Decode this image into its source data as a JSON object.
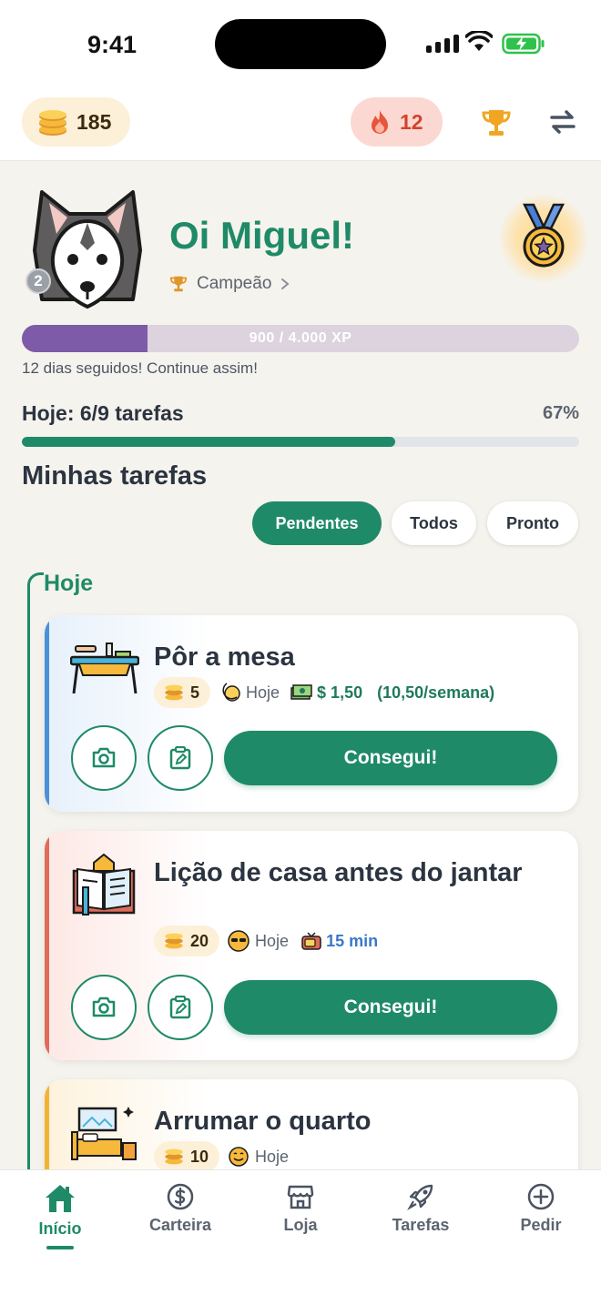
{
  "status_bar": {
    "time": "9:41"
  },
  "header": {
    "coins": "185",
    "streak": "12"
  },
  "profile": {
    "greeting": "Oi Miguel!",
    "rank_number": "2",
    "rank_name": "Campeão",
    "xp_text": "900 / 4.000 XP",
    "xp_progress": 0.225,
    "streak_message": "12 dias seguidos! Continue assim!"
  },
  "today": {
    "label": "Hoje: 6/9 tarefas",
    "percent": "67%",
    "progress": 0.67
  },
  "tasks_section": {
    "title": "Minhas tarefas",
    "tabs": [
      "Pendentes",
      "Todos",
      "Pronto"
    ],
    "group_label": "Hoje"
  },
  "tasks": [
    {
      "title": "Pôr a mesa",
      "coins": "5",
      "when": "Hoje",
      "money": "$ 1,50",
      "money_weekly": "(10,50/semana)",
      "action": "Consegui!",
      "accent": "#4a90d9"
    },
    {
      "title": "Lição de casa antes do jantar",
      "coins": "20",
      "when": "Hoje",
      "duration": "15 min",
      "action": "Consegui!",
      "accent": "#e06b5a"
    },
    {
      "title": "Arrumar o quarto",
      "coins": "10",
      "when": "Hoje",
      "accent": "#f2b233"
    }
  ],
  "nav": {
    "items": [
      "Início",
      "Carteira",
      "Loja",
      "Tarefas",
      "Pedir"
    ],
    "active": "Início"
  },
  "colors": {
    "primary": "#1f8a68",
    "xp": "#7e5ba8",
    "coin_bg": "#fdf0d8",
    "streak_bg": "#fcd8d2",
    "streak_text": "#d2442c"
  }
}
